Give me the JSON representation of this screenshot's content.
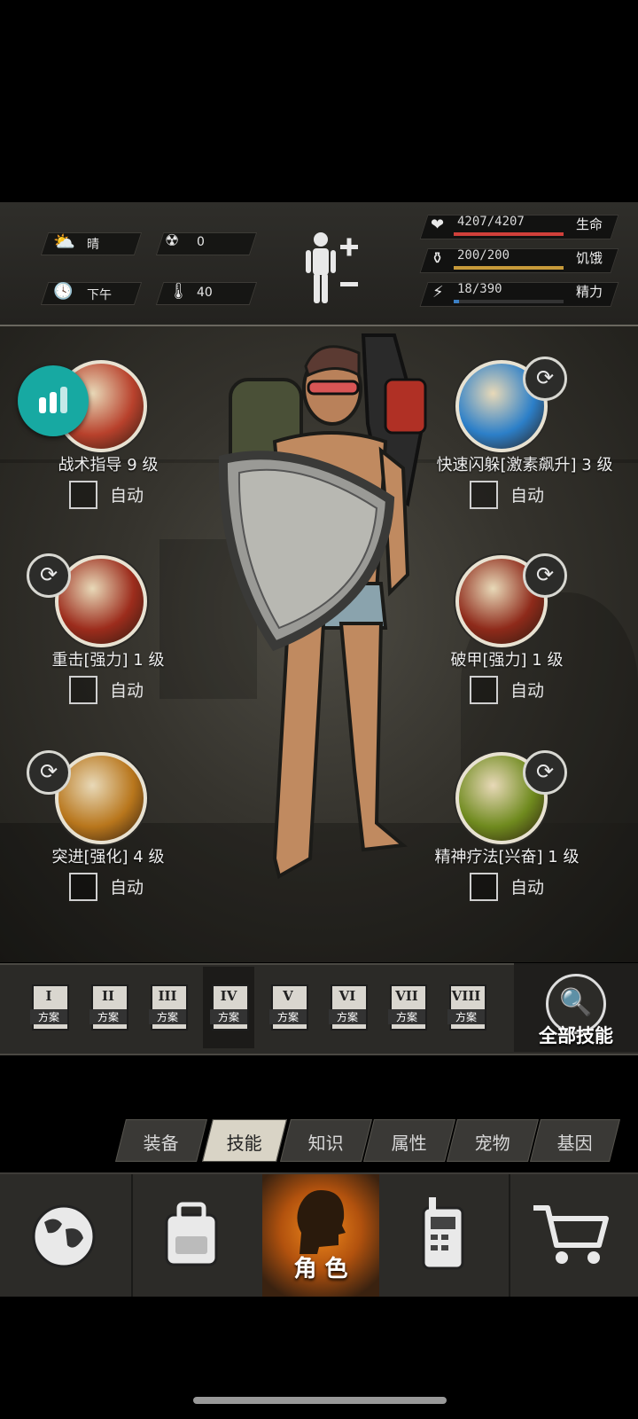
{
  "hud": {
    "weather": "晴",
    "radiation": "0",
    "time_of_day": "下午",
    "temperature": "40",
    "stats": [
      {
        "value": "4207/4207",
        "name": "生命",
        "fill": 1.0,
        "color": "#d0403a",
        "icon": "heart-icon"
      },
      {
        "value": "200/200",
        "name": "饥饿",
        "fill": 1.0,
        "color": "#c79a3a",
        "icon": "stomach-icon"
      },
      {
        "value": "18/390",
        "name": "精力",
        "fill": 0.046,
        "color": "#3b7fc4",
        "icon": "energy-icon"
      }
    ]
  },
  "skills": [
    {
      "name": "战术指导 9 级",
      "auto": "自动",
      "icon": "tactics-portrait-icon",
      "color": "#b8412c"
    },
    {
      "name": "快速闪躲[激素飙升] 3 级",
      "auto": "自动",
      "icon": "dodge-icon",
      "color": "#2c7fc8"
    },
    {
      "name": "重击[强力] 1 级",
      "auto": "自动",
      "icon": "heavy-strike-icon",
      "color": "#9c2c1c"
    },
    {
      "name": "破甲[强力] 1 级",
      "auto": "自动",
      "icon": "armor-break-icon",
      "color": "#8e2a1a"
    },
    {
      "name": "突进[强化] 4 级",
      "auto": "自动",
      "icon": "dash-icon",
      "color": "#b8761c"
    },
    {
      "name": "精神疗法[兴奋] 1 级",
      "auto": "自动",
      "icon": "mental-therapy-icon",
      "color": "#6f8a1e"
    }
  ],
  "plans": [
    {
      "num": "I",
      "label": "方案"
    },
    {
      "num": "II",
      "label": "方案"
    },
    {
      "num": "III",
      "label": "方案"
    },
    {
      "num": "IV",
      "label": "方案"
    },
    {
      "num": "V",
      "label": "方案"
    },
    {
      "num": "VI",
      "label": "方案"
    },
    {
      "num": "VII",
      "label": "方案"
    },
    {
      "num": "VIII",
      "label": "方案"
    }
  ],
  "active_plan": "IV",
  "all_skills_label": "全部技能",
  "tabs": [
    "装备",
    "技能",
    "知识",
    "属性",
    "宠物",
    "基因"
  ],
  "active_tab": "技能",
  "nav": {
    "role_label": "角 色",
    "items": [
      "globe-icon",
      "backpack-icon",
      "role-head-icon",
      "radio-icon",
      "cart-icon"
    ]
  }
}
